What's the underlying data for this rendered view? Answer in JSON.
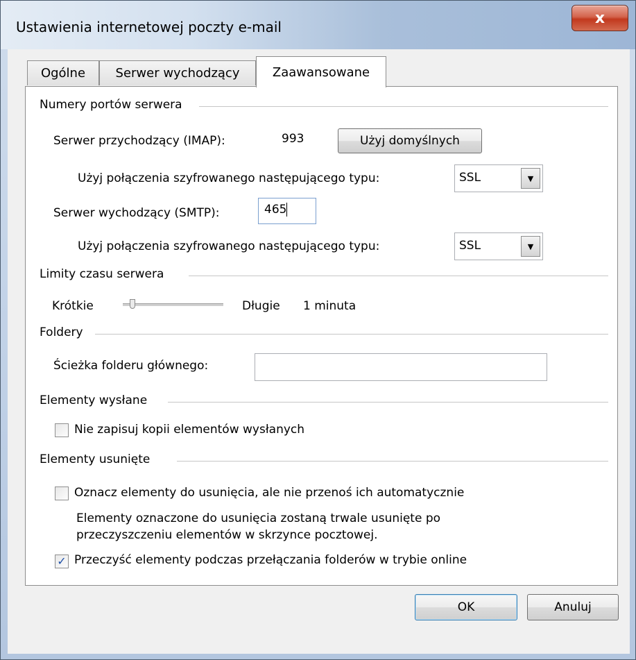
{
  "window": {
    "title": "Ustawienia internetowej poczty e-mail",
    "close_label": "x"
  },
  "tabs": [
    {
      "label": "Ogólne"
    },
    {
      "label": "Serwer wychodzący"
    },
    {
      "label": "Zaawansowane"
    }
  ],
  "ports": {
    "group_label": "Numery portów serwera",
    "incoming_label": "Serwer przychodzący (IMAP):",
    "incoming_value": "993",
    "default_button": "Użyj domyślnych",
    "encryption_label_1": "Użyj połączenia szyfrowanego następującego typu:",
    "encryption_value_1": "SSL",
    "outgoing_label": "Serwer wychodzący (SMTP):",
    "outgoing_value": "465",
    "encryption_label_2": "Użyj połączenia szyfrowanego następującego typu:",
    "encryption_value_2": "SSL"
  },
  "timeouts": {
    "group_label": "Limity czasu serwera",
    "short_label": "Krótkie",
    "long_label": "Długie",
    "value_label": "1 minuta",
    "slider_level": 0.0
  },
  "folders": {
    "group_label": "Foldery",
    "root_path_label": "Ścieżka folderu głównego:",
    "root_path_value": ""
  },
  "sent": {
    "group_label": "Elementy wysłane",
    "no_copy_label": "Nie zapisuj kopii elementów wysłanych",
    "no_copy_checked": false
  },
  "deleted": {
    "group_label": "Elementy usunięte",
    "mark_label": "Oznacz elementy do usunięcia, ale nie przenoś ich automatycznie",
    "mark_checked": false,
    "info_line_1": "Elementy oznaczone do usunięcia zostaną trwale usunięte po",
    "info_line_2": "przeczyszczeniu elementów w skrzynce pocztowej.",
    "purge_label": "Przeczyść elementy podczas przełączania folderów w trybie online",
    "purge_checked": true
  },
  "footer": {
    "ok_label": "OK",
    "cancel_label": "Anuluj"
  }
}
